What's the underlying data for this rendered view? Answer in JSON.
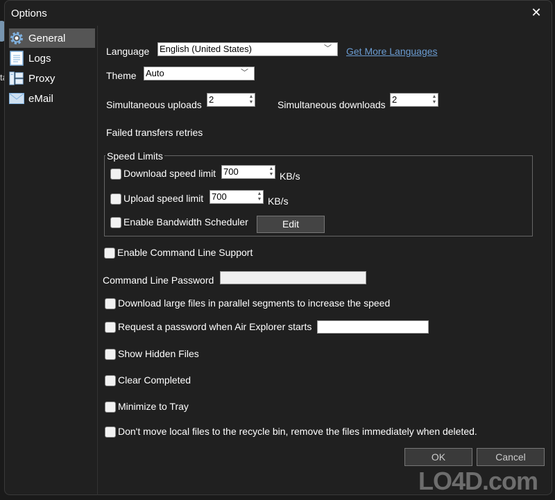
{
  "window": {
    "title": "Options",
    "close_label": "✕"
  },
  "background": {
    "peek_text": "ta"
  },
  "sidebar": {
    "items": [
      {
        "label": "General",
        "icon": "gear-icon",
        "active": true
      },
      {
        "label": "Logs",
        "icon": "document-icon",
        "active": false
      },
      {
        "label": "Proxy",
        "icon": "network-computers-icon",
        "active": false
      },
      {
        "label": "eMail",
        "icon": "envelope-icon",
        "active": false
      }
    ]
  },
  "general": {
    "language": {
      "label": "Language",
      "value": "English (United States)",
      "link": "Get More Languages"
    },
    "theme": {
      "label": "Theme",
      "value": "Auto"
    },
    "uploads": {
      "label": "Simultaneous uploads",
      "value": "2"
    },
    "downloads": {
      "label": "Simultaneous downloads",
      "value": "2"
    },
    "retries": {
      "label": "Failed transfers retries"
    },
    "speed_limits": {
      "legend": "Speed Limits",
      "download": {
        "label": "Download speed limit",
        "value": "700",
        "unit": "KB/s",
        "checked": false
      },
      "upload": {
        "label": "Upload speed limit",
        "value": "700",
        "unit": "KB/s",
        "checked": false
      },
      "scheduler": {
        "label": "Enable Bandwidth Scheduler",
        "checked": false,
        "button": "Edit"
      }
    },
    "cmdline_support": {
      "label": "Enable Command Line Support",
      "checked": false
    },
    "cmdline_password": {
      "label": "Command Line Password",
      "value": ""
    },
    "parallel": {
      "label": "Download large files in parallel segments to increase the speed",
      "checked": false
    },
    "request_password": {
      "label": "Request a password when Air Explorer starts",
      "checked": false,
      "value": ""
    },
    "hidden_files": {
      "label": "Show Hidden Files",
      "checked": false
    },
    "clear_completed": {
      "label": "Clear Completed",
      "checked": false
    },
    "minimize_tray": {
      "label": "Minimize to Tray",
      "checked": false
    },
    "no_recycle": {
      "label": "Don't move local files to the recycle bin, remove the files immediately when deleted.",
      "checked": false
    }
  },
  "footer": {
    "ok": "OK",
    "cancel": "Cancel"
  },
  "watermark": "LO4D.com"
}
